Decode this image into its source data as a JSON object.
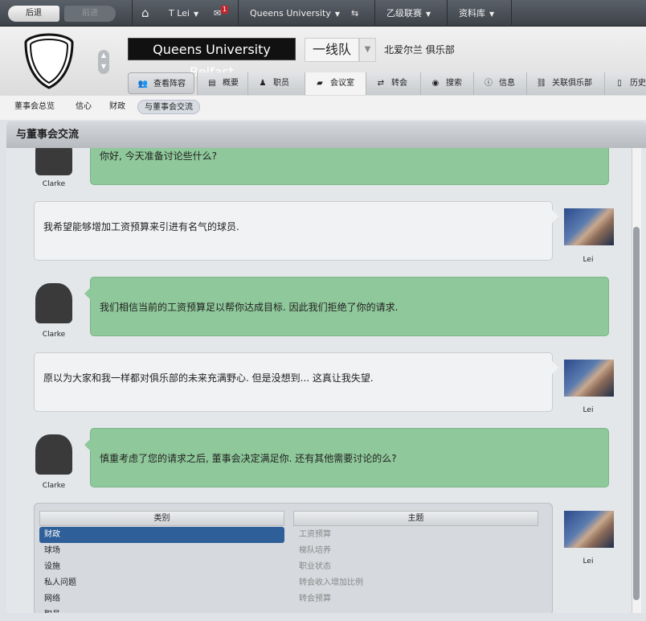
{
  "topbar": {
    "back": "后退",
    "forward": "前进",
    "user": "T Lei",
    "mail_count": "1",
    "club": "Queens University",
    "league": "乙级联赛",
    "database": "资料库"
  },
  "header": {
    "club_name": "Queens University Belfast",
    "squad": "一线队",
    "region": "北爱尔兰 俱乐部"
  },
  "tabs": [
    {
      "label": "查看阵容",
      "icon": "squad-icon"
    },
    {
      "label": "概要",
      "icon": "profile-icon"
    },
    {
      "label": "职员",
      "icon": "staff-icon"
    },
    {
      "label": "会议室",
      "icon": "briefcase-icon"
    },
    {
      "label": "转会",
      "icon": "transfer-icon"
    },
    {
      "label": "搜索",
      "icon": "binoculars-icon"
    },
    {
      "label": "信息",
      "icon": "info-icon"
    },
    {
      "label": "关联俱乐部",
      "icon": "link-icon"
    },
    {
      "label": "历史",
      "icon": "history-icon"
    }
  ],
  "subtabs": [
    "董事会总览",
    "信心",
    "财政",
    "与董事会交流"
  ],
  "panel_title": "与董事会交流",
  "messages": [
    {
      "from": "Clarke",
      "text": "你好, 今天准备讨论些什么?"
    },
    {
      "from": "Lei",
      "text": "我希望能够增加工资预算来引进有名气的球员."
    },
    {
      "from": "Clarke",
      "text": "我们相信当前的工资预算足以帮你达成目标. 因此我们拒绝了你的请求."
    },
    {
      "from": "Lei",
      "text": "原以为大家和我一样都对俱乐部的未来充满野心. 但是没想到... 这真让我失望."
    },
    {
      "from": "Clarke",
      "text": "慎重考虑了您的请求之后, 董事会决定满足你. 还有其他需要讨论的么?"
    }
  ],
  "selector": {
    "category_header": "类别",
    "topic_header": "主题",
    "categories": [
      "财政",
      "球场",
      "设施",
      "私人问题",
      "网络",
      "职员"
    ],
    "selected": "财政",
    "topics": [
      "工资预算",
      "梯队培养",
      "职业状态",
      "转会收入增加比例",
      "转会预算"
    ],
    "user": "Lei"
  }
}
